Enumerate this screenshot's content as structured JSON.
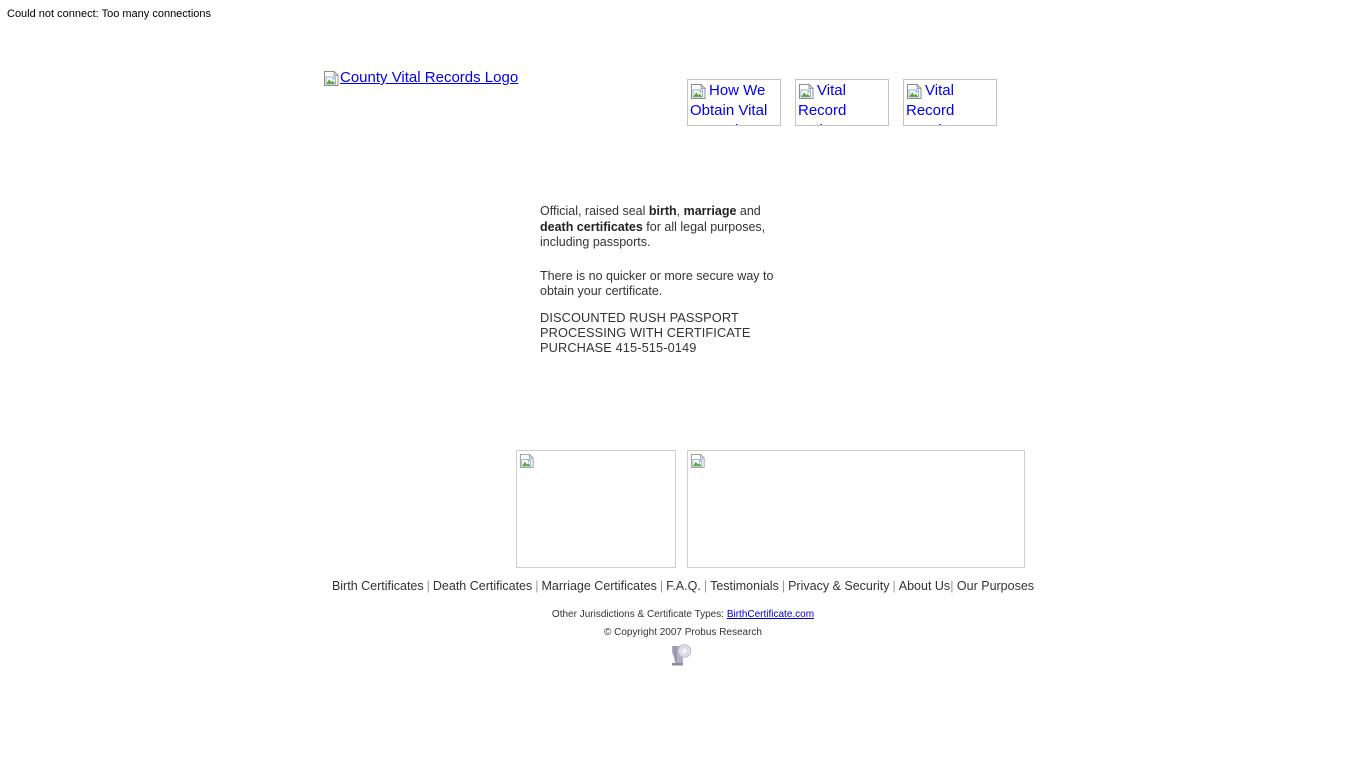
{
  "error_banner": {
    "text": "Could not connect: Too many connections"
  },
  "header": {
    "logo": {
      "alt_text": "County Vital Records Logo",
      "icon": "broken-image-icon",
      "link_color": "#0000ee"
    },
    "nav_buttons": [
      {
        "alt_text": "How We Obtain Vital Records",
        "icon": "broken-image-icon"
      },
      {
        "alt_text": "Vital Record Order",
        "icon": "broken-image-icon"
      },
      {
        "alt_text": "Vital Record Reprint",
        "icon": "broken-image-icon"
      }
    ]
  },
  "main": {
    "intro": {
      "part1": "Official, raised seal ",
      "bold1": "birth",
      "part2": ", ",
      "bold2": "marriage",
      "part3": " and ",
      "bold3": "death certificates",
      "part4": " for all legal purposes, including passports."
    },
    "secure_line": "There is no quicker or more secure way to obtain your certificate.",
    "promo": "DISCOUNTED RUSH PASSPORT PROCESSING WITH CERTIFICATE PURCHASE 415-515-0149",
    "placeholder_boxes": [
      {
        "icon": "broken-image-icon",
        "alt_text": ""
      },
      {
        "icon": "broken-image-icon",
        "alt_text": ""
      }
    ]
  },
  "footer": {
    "links": [
      {
        "label": "Birth Certificates"
      },
      {
        "label": "Death Certificates"
      },
      {
        "label": "Marriage Certificates"
      },
      {
        "label": "F.A.Q."
      },
      {
        "label": "Testimonials"
      },
      {
        "label": "Privacy & Security"
      },
      {
        "label": "About Us"
      },
      {
        "label": "Our Purposes"
      }
    ],
    "separator": "|",
    "other_jurisdictions_label": "Other Jurisdictions & Certificate Types:",
    "other_jurisdictions_link": "BirthCertificate.com",
    "copyright": "© Copyright 2007 Probus Research",
    "badge_icon": "partial-image-badge"
  }
}
